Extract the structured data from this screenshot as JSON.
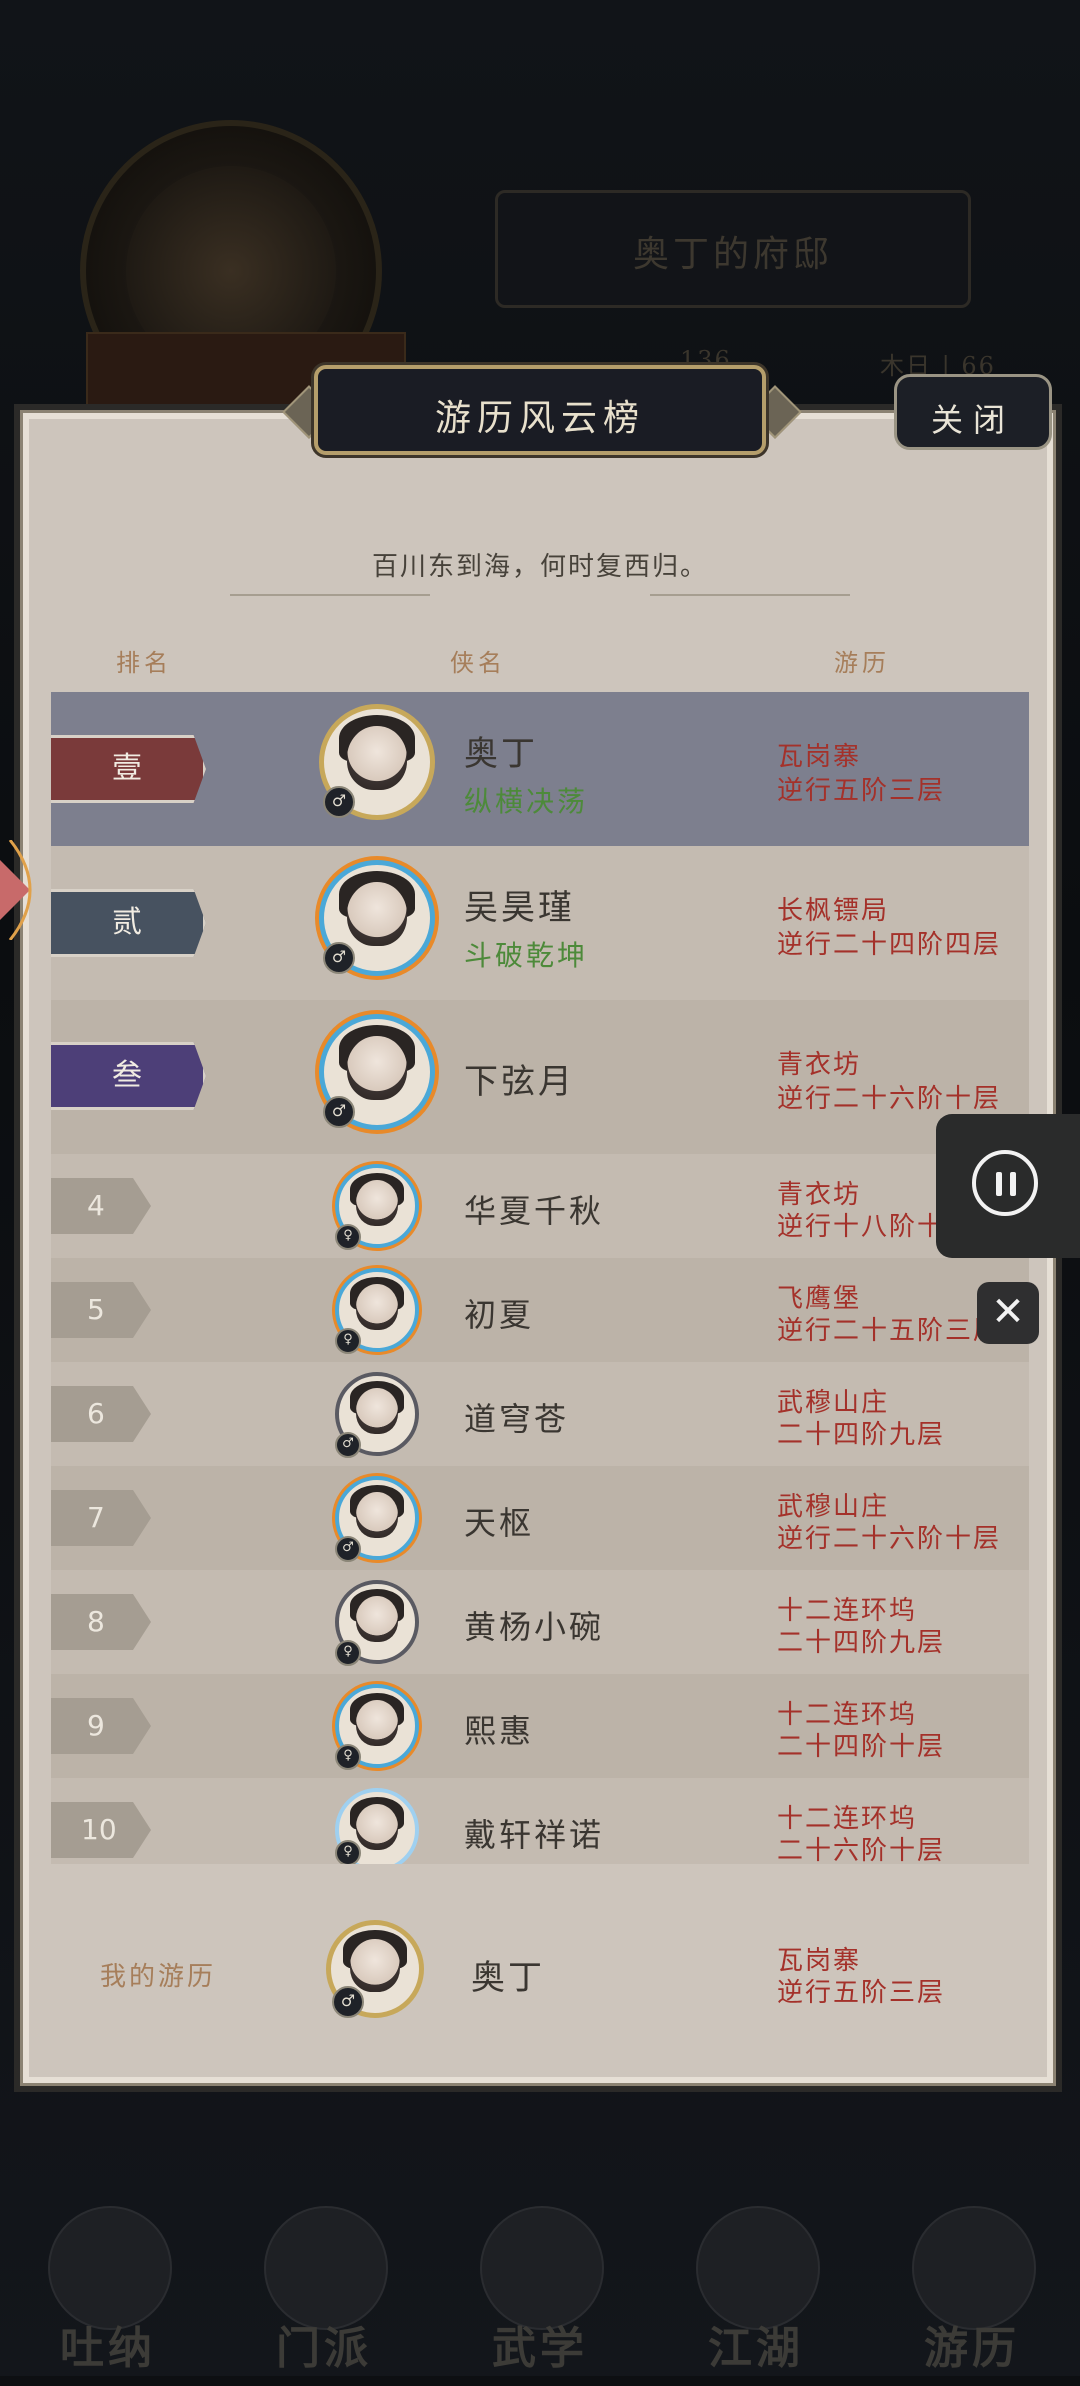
{
  "background": {
    "title": "奥丁的府邸",
    "nav": [
      {
        "label": "吐纳",
        "icon": "meditate-icon"
      },
      {
        "label": "门派",
        "icon": "sect-icon"
      },
      {
        "label": "武学",
        "icon": "martial-arts-icon"
      },
      {
        "label": "江湖",
        "icon": "jianghu-icon"
      },
      {
        "label": "游历",
        "icon": "travel-icon"
      }
    ],
    "stat_a": "136",
    "stat_b": "木日 | 66"
  },
  "panel": {
    "title": "游历风云榜",
    "close_label": "关闭",
    "motto": "百川东到海，何时复西归。",
    "columns": {
      "rank": "排名",
      "name": "侠名",
      "travel": "游历"
    }
  },
  "leaderboard": [
    {
      "rank": "壹",
      "name": "奥丁",
      "title": "纵横决荡",
      "loc1": "瓦岗寨",
      "loc2": "逆行五阶三层",
      "gender": "♂"
    },
    {
      "rank": "贰",
      "name": "吴昊瑾",
      "title": "斗破乾坤",
      "loc1": "长枫镖局",
      "loc2": "逆行二十四阶四层",
      "gender": "♂"
    },
    {
      "rank": "叁",
      "name": "下弦月",
      "title": "",
      "loc1": "青衣坊",
      "loc2": "逆行二十六阶十层",
      "gender": "♂"
    },
    {
      "rank": "4",
      "name": "华夏千秋",
      "title": "",
      "loc1": "青衣坊",
      "loc2": "逆行十八阶十层",
      "gender": "♀"
    },
    {
      "rank": "5",
      "name": "初夏",
      "title": "",
      "loc1": "飞鹰堡",
      "loc2": "逆行二十五阶三层",
      "gender": "♀"
    },
    {
      "rank": "6",
      "name": "道穹苍",
      "title": "",
      "loc1": "武穆山庄",
      "loc2": "二十四阶九层",
      "gender": "♂"
    },
    {
      "rank": "7",
      "name": "天枢",
      "title": "",
      "loc1": "武穆山庄",
      "loc2": "逆行二十六阶十层",
      "gender": "♂"
    },
    {
      "rank": "8",
      "name": "黄杨小碗",
      "title": "",
      "loc1": "十二连环坞",
      "loc2": "二十四阶九层",
      "gender": "♀"
    },
    {
      "rank": "9",
      "name": "熙惠",
      "title": "",
      "loc1": "十二连环坞",
      "loc2": "二十四阶十层",
      "gender": "♀"
    },
    {
      "rank": "10",
      "name": "戴轩祥诺",
      "title": "",
      "loc1": "十二连环坞",
      "loc2": "二十六阶十层",
      "gender": "♀"
    }
  ],
  "my_travel": {
    "label": "我的游历",
    "name": "奥丁",
    "loc1": "瓦岗寨",
    "loc2": "逆行五阶三层",
    "gender": "♂"
  },
  "overlay": {
    "close_glyph": "✕"
  },
  "colors": {
    "panel": "#cdc5bc",
    "top1_row": "#7d7f8e",
    "rank_red": "#7a3a3a",
    "rank_slate": "#475260",
    "rank_purple": "#4d3f78",
    "location_red": "#a4312a",
    "title_green": "#4d8a3a",
    "header_brown": "#a67e5a"
  }
}
